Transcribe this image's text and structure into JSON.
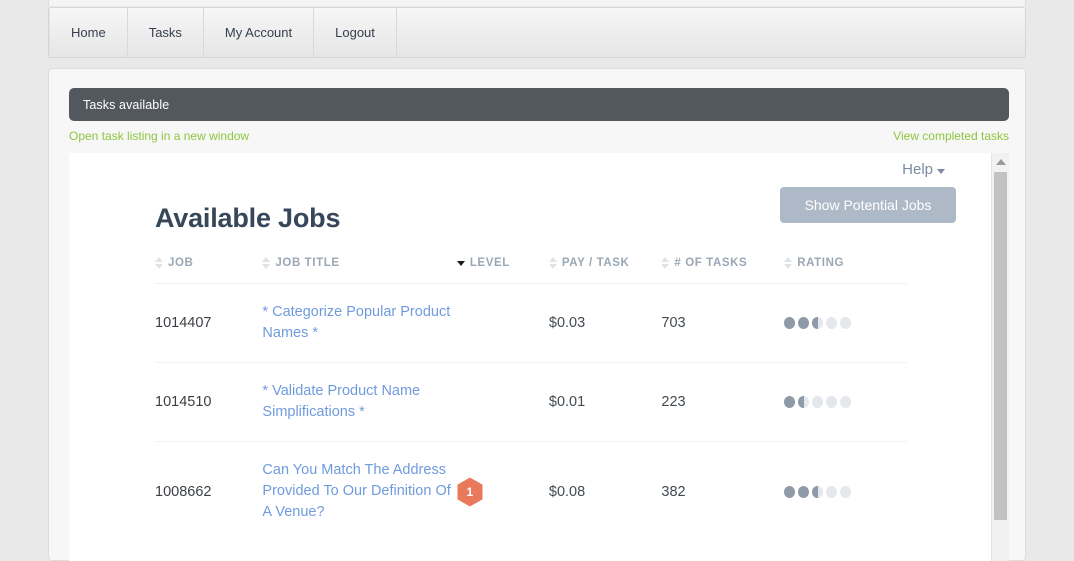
{
  "nav": {
    "tabs": [
      {
        "label": "Home"
      },
      {
        "label": "Tasks"
      },
      {
        "label": "My Account"
      },
      {
        "label": "Logout"
      }
    ]
  },
  "panel": {
    "title": "Tasks available",
    "links": {
      "open_listing": "Open task listing in a new window",
      "view_completed": "View completed tasks"
    }
  },
  "content": {
    "help_label": "Help",
    "page_title": "Available Jobs",
    "show_potential_button": "Show Potential Jobs"
  },
  "table": {
    "columns": [
      {
        "label": "JOB",
        "sort": "inactive"
      },
      {
        "label": "JOB TITLE",
        "sort": "inactive"
      },
      {
        "label": "LEVEL",
        "sort": "desc"
      },
      {
        "label": "PAY / TASK",
        "sort": "inactive"
      },
      {
        "label": "# OF TASKS",
        "sort": "inactive"
      },
      {
        "label": "RATING",
        "sort": "inactive"
      }
    ],
    "rows": [
      {
        "job": "1014407",
        "title": "* Categorize Popular Product Names *",
        "level": "",
        "pay": "$0.03",
        "tasks": "703",
        "rating": 2.5
      },
      {
        "job": "1014510",
        "title": "* Validate Product Name Simplifications *",
        "level": "",
        "pay": "$0.01",
        "tasks": "223",
        "rating": 1.5
      },
      {
        "job": "1008662",
        "title": "Can You Match The Address Provided To Our Definition Of A Venue?",
        "level": "1",
        "pay": "$0.08",
        "tasks": "382",
        "rating": 2.5
      }
    ]
  },
  "colors": {
    "panel_header_bg": "#53585e",
    "link_green": "#8dc63f",
    "link_blue": "#6f9bdd",
    "button_gray_blue": "#aeb9c7",
    "badge_orange": "#e8795a",
    "title_navy": "#37475a",
    "dot_filled": "#8e9aa8",
    "dot_empty": "#e4e8ec"
  },
  "scrollbar": {
    "arrow_up": "scroll-up-arrow"
  }
}
